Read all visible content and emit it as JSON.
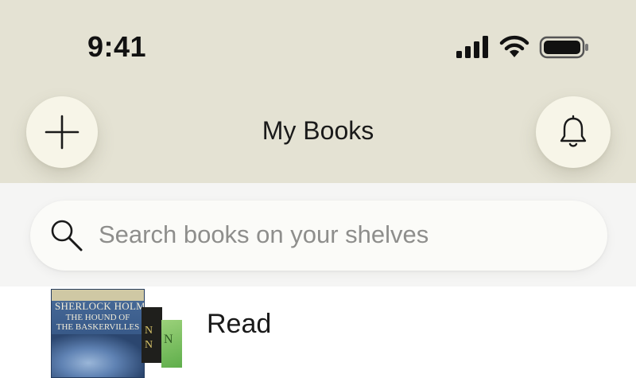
{
  "status_bar": {
    "time": "9:41",
    "icons": [
      "cellular-signal-icon",
      "wifi-icon",
      "battery-icon"
    ]
  },
  "header": {
    "title": "My Books",
    "add_button_icon": "plus-icon",
    "notifications_button_icon": "bell-icon"
  },
  "search": {
    "placeholder": "Search books on your shelves",
    "value": "",
    "icon": "search-icon"
  },
  "shelves": [
    {
      "name": "Read",
      "count_label": "",
      "covers": [
        {
          "series": "SHERLOCK HOLMES",
          "title_line1": "THE HOUND OF",
          "title_line2": "THE BASKERVILLES"
        }
      ]
    }
  ],
  "colors": {
    "header_bg": "#e4e2d3",
    "button_bg": "#f7f5e8",
    "search_band_bg": "#f5f5f4",
    "placeholder": "#8e8e8c"
  }
}
